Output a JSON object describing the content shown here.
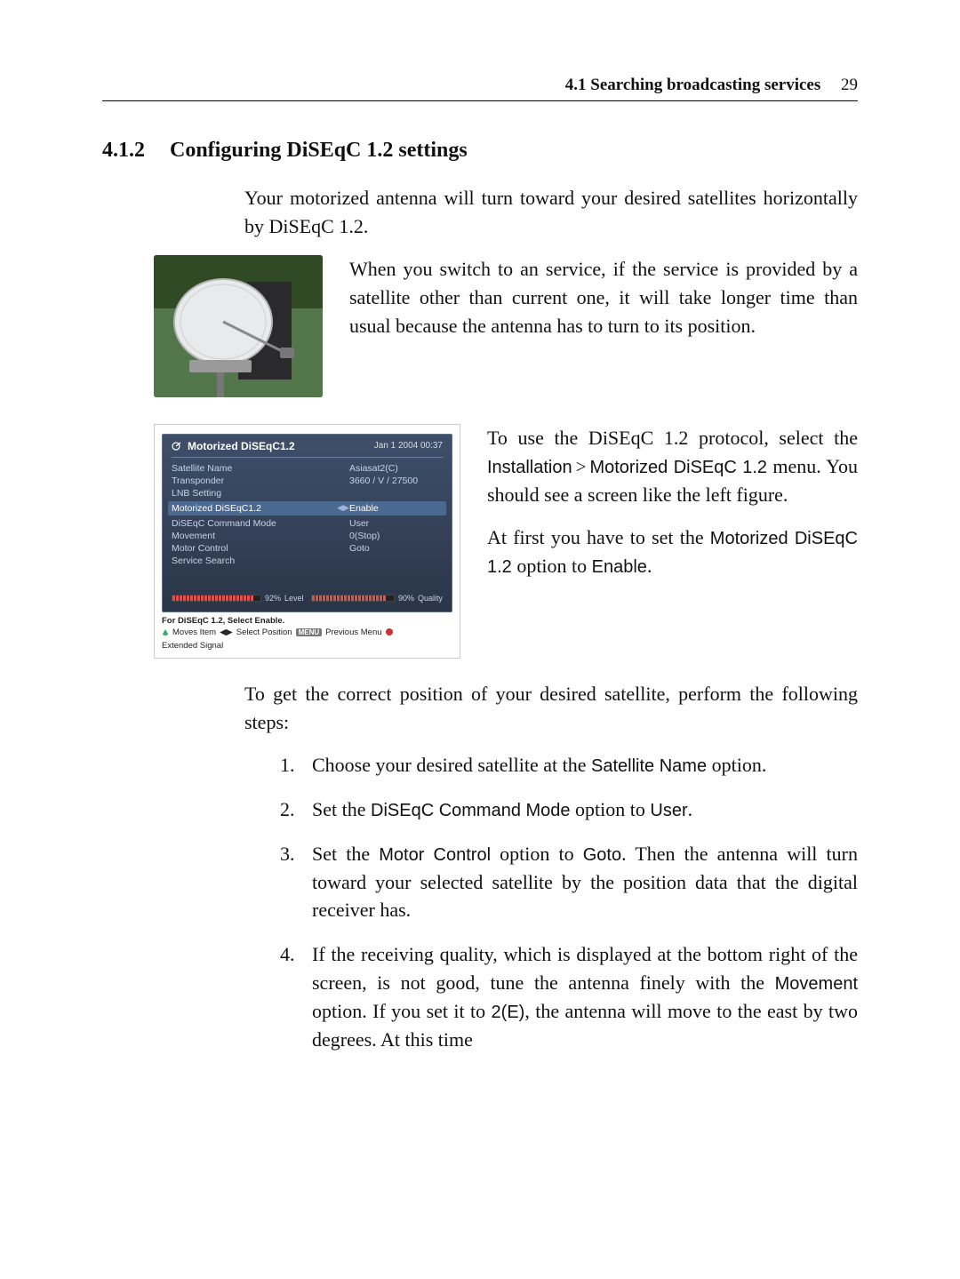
{
  "running_head": {
    "section": "4.1 Searching broadcasting services",
    "page_number": "29"
  },
  "heading": {
    "number": "4.1.2",
    "title": "Configuring DiSEqC 1.2 settings"
  },
  "intro_para": "Your motorized antenna will turn toward your desired satellites horizontally by DiSEqC 1.2.",
  "fig1_side": "When you switch to an service, if the service is provided by a satellite other than current one, it will take longer time than usual because the antenna has to turn to its position.",
  "osd": {
    "title": "Motorized DiSEqC1.2",
    "timestamp": "Jan 1 2004 00:37",
    "rows": [
      {
        "label": "Satellite Name",
        "value": "Asiasat2(C)"
      },
      {
        "label": "Transponder",
        "value": "3660 / V / 27500"
      },
      {
        "label": "LNB Setting",
        "value": ""
      }
    ],
    "hl_row": {
      "label": "Motorized DiSEqC1.2",
      "value": "Enable"
    },
    "rows2": [
      {
        "label": "DiSEqC Command Mode",
        "value": "User"
      },
      {
        "label": "Movement",
        "value": "0(Stop)"
      },
      {
        "label": "Motor Control",
        "value": "Goto"
      },
      {
        "label": "Service Search",
        "value": ""
      }
    ],
    "level": {
      "pct": 92,
      "pct_text": "92%",
      "label": "Level"
    },
    "quality": {
      "pct": 90,
      "pct_text": "90%",
      "label": "Quality"
    },
    "footer_line": "For DiSEqC 1.2, Select Enable.",
    "hints": {
      "moves": "Moves Item",
      "select": "Select Position",
      "menu_chip": "MENU",
      "prev": "Previous Menu",
      "ext": "Extended Signal"
    }
  },
  "side2": {
    "p1_a": "To use the DiSEqC 1.2 protocol, select the ",
    "p1_install": "Installation",
    "p1_gt": ">",
    "p1_menu": "Motorized DiSEqC 1.2",
    "p1_b": " menu. You should see a screen like the left figure.",
    "p2_a": "At first you have to set the ",
    "p2_opt": "Motorized DiSEqC 1.2",
    "p2_b": " option to ",
    "p2_enable": "Enable",
    "p2_c": "."
  },
  "steps_intro": "To get the correct position of your desired satellite, perform the following steps:",
  "steps": {
    "s1_a": "Choose your desired satellite at the ",
    "s1_opt": "Satellite Name",
    "s1_b": " option.",
    "s2_a": "Set the ",
    "s2_opt": "DiSEqC Command Mode",
    "s2_b": " option to ",
    "s2_val": "User",
    "s2_c": ".",
    "s3_a": "Set the ",
    "s3_opt": "Motor Control",
    "s3_b": " option to ",
    "s3_val": "Goto",
    "s3_c": ". Then the antenna will turn toward your selected satellite by the position data that the digital receiver has.",
    "s4_a": "If the receiving quality, which is displayed at the bottom right of the screen, is not good, tune the antenna finely with the ",
    "s4_opt": "Movement",
    "s4_b": " option. If you set it to ",
    "s4_val": "2(E)",
    "s4_c": ", the antenna will move to the east by two degrees. At this time"
  }
}
